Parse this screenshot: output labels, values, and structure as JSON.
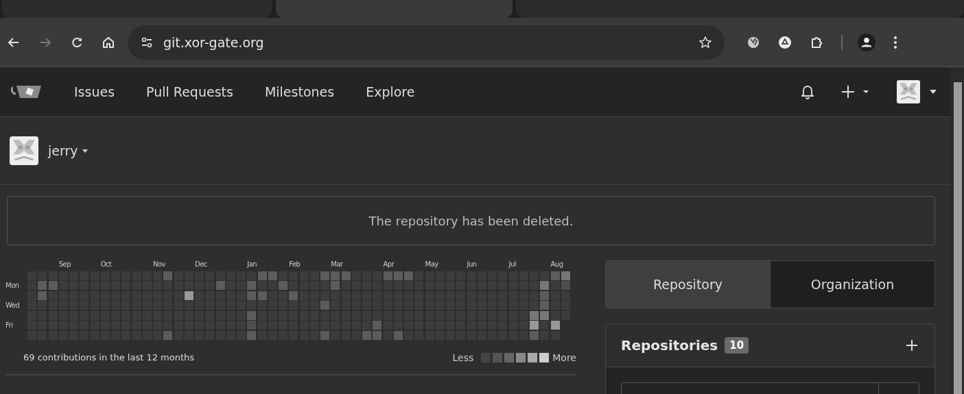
{
  "browser_tabs": [
    {
      "selected": false
    },
    {
      "selected": true
    },
    {
      "selected": false
    }
  ],
  "browser": {
    "url": "git.xor-gate.org",
    "forward_disabled": true
  },
  "nav": {
    "items": [
      "Issues",
      "Pull Requests",
      "Milestones",
      "Explore"
    ]
  },
  "user": {
    "name": "jerry"
  },
  "alert": "The repository has been deleted.",
  "heatmap": {
    "days": [
      "Mon",
      "Wed",
      "Fri"
    ],
    "weeks": [
      {
        "days": [
          {
            "color": "#3c3c3c"
          },
          {
            "color": "#3c3c3c"
          },
          {
            "color": "#3c3c3c"
          },
          {
            "color": "#3c3c3c"
          },
          {
            "color": "#3c3c3c"
          },
          {
            "color": "#3c3c3c"
          },
          {
            "color": "#3c3c3c"
          }
        ]
      },
      {
        "days": [
          {
            "color": "#3c3c3c"
          },
          {
            "color": "#5c5c5c"
          },
          {
            "color": "#5c5c5c"
          },
          {
            "color": "#3c3c3c"
          },
          {
            "color": "#3c3c3c"
          },
          {
            "color": "#3c3c3c"
          },
          {
            "color": "#3c3c3c"
          }
        ]
      },
      {
        "days": [
          {
            "color": "#3c3c3c"
          },
          {
            "color": "#5c5c5c"
          },
          {
            "color": "#3c3c3c"
          },
          {
            "color": "#3c3c3c"
          },
          {
            "color": "#3c3c3c"
          },
          {
            "color": "#3c3c3c"
          },
          {
            "color": "#3c3c3c"
          }
        ]
      },
      {
        "month": "Sep",
        "days": [
          {
            "color": "#3c3c3c"
          },
          {
            "color": "#3c3c3c"
          },
          {
            "color": "#3c3c3c"
          },
          {
            "color": "#3c3c3c"
          },
          {
            "color": "#3c3c3c"
          },
          {
            "color": "#3c3c3c"
          },
          {
            "color": "#3c3c3c"
          }
        ]
      },
      {
        "days": [
          {
            "color": "#3c3c3c"
          },
          {
            "color": "#3c3c3c"
          },
          {
            "color": "#3c3c3c"
          },
          {
            "color": "#3c3c3c"
          },
          {
            "color": "#3c3c3c"
          },
          {
            "color": "#3c3c3c"
          },
          {
            "color": "#3c3c3c"
          }
        ]
      },
      {
        "days": [
          {
            "color": "#3c3c3c"
          },
          {
            "color": "#3c3c3c"
          },
          {
            "color": "#3c3c3c"
          },
          {
            "color": "#3c3c3c"
          },
          {
            "color": "#3c3c3c"
          },
          {
            "color": "#3c3c3c"
          },
          {
            "color": "#3c3c3c"
          }
        ]
      },
      {
        "days": [
          {
            "color": "#3c3c3c"
          },
          {
            "color": "#3c3c3c"
          },
          {
            "color": "#3c3c3c"
          },
          {
            "color": "#3c3c3c"
          },
          {
            "color": "#3c3c3c"
          },
          {
            "color": "#3c3c3c"
          },
          {
            "color": "#3c3c3c"
          }
        ]
      },
      {
        "month": "Oct",
        "days": [
          {
            "color": "#3c3c3c"
          },
          {
            "color": "#3c3c3c"
          },
          {
            "color": "#3c3c3c"
          },
          {
            "color": "#3c3c3c"
          },
          {
            "color": "#3c3c3c"
          },
          {
            "color": "#3c3c3c"
          },
          {
            "color": "#3c3c3c"
          }
        ]
      },
      {
        "days": [
          {
            "color": "#3c3c3c"
          },
          {
            "color": "#3c3c3c"
          },
          {
            "color": "#3c3c3c"
          },
          {
            "color": "#3c3c3c"
          },
          {
            "color": "#3c3c3c"
          },
          {
            "color": "#3c3c3c"
          },
          {
            "color": "#3c3c3c"
          }
        ]
      },
      {
        "days": [
          {
            "color": "#3c3c3c"
          },
          {
            "color": "#3c3c3c"
          },
          {
            "color": "#3c3c3c"
          },
          {
            "color": "#3c3c3c"
          },
          {
            "color": "#3c3c3c"
          },
          {
            "color": "#3c3c3c"
          },
          {
            "color": "#3c3c3c"
          }
        ]
      },
      {
        "days": [
          {
            "color": "#3c3c3c"
          },
          {
            "color": "#3c3c3c"
          },
          {
            "color": "#3c3c3c"
          },
          {
            "color": "#3c3c3c"
          },
          {
            "color": "#3c3c3c"
          },
          {
            "color": "#3c3c3c"
          },
          {
            "color": "#3c3c3c"
          }
        ]
      },
      {
        "days": [
          {
            "color": "#3c3c3c"
          },
          {
            "color": "#3c3c3c"
          },
          {
            "color": "#3c3c3c"
          },
          {
            "color": "#3c3c3c"
          },
          {
            "color": "#3c3c3c"
          },
          {
            "color": "#3c3c3c"
          },
          {
            "color": "#3c3c3c"
          }
        ]
      },
      {
        "month": "Nov",
        "days": [
          {
            "color": "#3c3c3c"
          },
          {
            "color": "#3c3c3c"
          },
          {
            "color": "#3c3c3c"
          },
          {
            "color": "#3c3c3c"
          },
          {
            "color": "#3c3c3c"
          },
          {
            "color": "#3c3c3c"
          },
          {
            "color": "#3c3c3c"
          }
        ]
      },
      {
        "days": [
          {
            "color": "#5c5c5c"
          },
          {
            "color": "#3c3c3c"
          },
          {
            "color": "#3c3c3c"
          },
          {
            "color": "#3c3c3c"
          },
          {
            "color": "#3c3c3c"
          },
          {
            "color": "#3c3c3c"
          },
          {
            "color": "#5c5c5c"
          }
        ]
      },
      {
        "days": [
          {
            "color": "#3c3c3c"
          },
          {
            "color": "#3c3c3c"
          },
          {
            "color": "#3c3c3c"
          },
          {
            "color": "#3c3c3c"
          },
          {
            "color": "#3c3c3c"
          },
          {
            "color": "#3c3c3c"
          },
          {
            "color": "#3c3c3c"
          }
        ]
      },
      {
        "days": [
          {
            "color": "#3c3c3c"
          },
          {
            "color": "#3c3c3c"
          },
          {
            "color": "#999999"
          },
          {
            "color": "#3c3c3c"
          },
          {
            "color": "#3c3c3c"
          },
          {
            "color": "#3c3c3c"
          },
          {
            "color": "#3c3c3c"
          }
        ]
      },
      {
        "month": "Dec",
        "days": [
          {
            "color": "#3c3c3c"
          },
          {
            "color": "#3c3c3c"
          },
          {
            "color": "#3c3c3c"
          },
          {
            "color": "#3c3c3c"
          },
          {
            "color": "#3c3c3c"
          },
          {
            "color": "#3c3c3c"
          },
          {
            "color": "#3c3c3c"
          }
        ]
      },
      {
        "days": [
          {
            "color": "#3c3c3c"
          },
          {
            "color": "#3c3c3c"
          },
          {
            "color": "#3c3c3c"
          },
          {
            "color": "#3c3c3c"
          },
          {
            "color": "#3c3c3c"
          },
          {
            "color": "#3c3c3c"
          },
          {
            "color": "#3c3c3c"
          }
        ]
      },
      {
        "days": [
          {
            "color": "#3c3c3c"
          },
          {
            "color": "#5c5c5c"
          },
          {
            "color": "#3c3c3c"
          },
          {
            "color": "#3c3c3c"
          },
          {
            "color": "#3c3c3c"
          },
          {
            "color": "#3c3c3c"
          },
          {
            "color": "#3c3c3c"
          }
        ]
      },
      {
        "days": [
          {
            "color": "#3c3c3c"
          },
          {
            "color": "#3c3c3c"
          },
          {
            "color": "#3c3c3c"
          },
          {
            "color": "#3c3c3c"
          },
          {
            "color": "#3c3c3c"
          },
          {
            "color": "#3c3c3c"
          },
          {
            "color": "#3c3c3c"
          }
        ]
      },
      {
        "days": [
          {
            "color": "#3c3c3c"
          },
          {
            "color": "#3c3c3c"
          },
          {
            "color": "#3c3c3c"
          },
          {
            "color": "#3c3c3c"
          },
          {
            "color": "#3c3c3c"
          },
          {
            "color": "#3c3c3c"
          },
          {
            "color": "#3c3c3c"
          }
        ]
      },
      {
        "month": "Jan",
        "days": [
          {
            "color": "#3c3c3c"
          },
          {
            "color": "#5c5c5c"
          },
          {
            "color": "#5c5c5c"
          },
          {
            "color": "#3c3c3c"
          },
          {
            "color": "#5c5c5c"
          },
          {
            "color": "#4e4e4e"
          },
          {
            "color": "#5c5c5c"
          }
        ]
      },
      {
        "days": [
          {
            "color": "#5c5c5c"
          },
          {
            "color": "#3c3c3c"
          },
          {
            "color": "#5c5c5c"
          },
          {
            "color": "#3c3c3c"
          },
          {
            "color": "#3c3c3c"
          },
          {
            "color": "#3c3c3c"
          },
          {
            "color": "#3c3c3c"
          }
        ]
      },
      {
        "days": [
          {
            "color": "#5c5c5c"
          },
          {
            "color": "#3c3c3c"
          },
          {
            "color": "#3c3c3c"
          },
          {
            "color": "#3c3c3c"
          },
          {
            "color": "#3c3c3c"
          },
          {
            "color": "#3c3c3c"
          },
          {
            "color": "#3c3c3c"
          }
        ]
      },
      {
        "days": [
          {
            "color": "#3c3c3c"
          },
          {
            "color": "#5c5c5c"
          },
          {
            "color": "#3c3c3c"
          },
          {
            "color": "#3c3c3c"
          },
          {
            "color": "#3c3c3c"
          },
          {
            "color": "#3c3c3c"
          },
          {
            "color": "#3c3c3c"
          }
        ]
      },
      {
        "month": "Feb",
        "days": [
          {
            "color": "#3c3c3c"
          },
          {
            "color": "#3c3c3c"
          },
          {
            "color": "#5c5c5c"
          },
          {
            "color": "#3c3c3c"
          },
          {
            "color": "#3c3c3c"
          },
          {
            "color": "#3c3c3c"
          },
          {
            "color": "#3c3c3c"
          }
        ]
      },
      {
        "days": [
          {
            "color": "#3c3c3c"
          },
          {
            "color": "#3c3c3c"
          },
          {
            "color": "#3c3c3c"
          },
          {
            "color": "#3c3c3c"
          },
          {
            "color": "#3c3c3c"
          },
          {
            "color": "#3c3c3c"
          },
          {
            "color": "#3c3c3c"
          }
        ]
      },
      {
        "days": [
          {
            "color": "#3c3c3c"
          },
          {
            "color": "#3c3c3c"
          },
          {
            "color": "#3c3c3c"
          },
          {
            "color": "#3c3c3c"
          },
          {
            "color": "#3c3c3c"
          },
          {
            "color": "#3c3c3c"
          },
          {
            "color": "#3c3c3c"
          }
        ]
      },
      {
        "days": [
          {
            "color": "#5c5c5c"
          },
          {
            "color": "#3c3c3c"
          },
          {
            "color": "#3c3c3c"
          },
          {
            "color": "#5c5c5c"
          },
          {
            "color": "#3c3c3c"
          },
          {
            "color": "#3c3c3c"
          },
          {
            "color": "#5c5c5c"
          }
        ]
      },
      {
        "month": "Mar",
        "days": [
          {
            "color": "#5c5c5c"
          },
          {
            "color": "#5c5c5c"
          },
          {
            "color": "#3c3c3c"
          },
          {
            "color": "#3c3c3c"
          },
          {
            "color": "#3c3c3c"
          },
          {
            "color": "#3c3c3c"
          },
          {
            "color": "#3c3c3c"
          }
        ]
      },
      {
        "days": [
          {
            "color": "#5c5c5c"
          },
          {
            "color": "#3c3c3c"
          },
          {
            "color": "#3c3c3c"
          },
          {
            "color": "#3c3c3c"
          },
          {
            "color": "#3c3c3c"
          },
          {
            "color": "#3c3c3c"
          },
          {
            "color": "#3c3c3c"
          }
        ]
      },
      {
        "days": [
          {
            "color": "#3c3c3c"
          },
          {
            "color": "#3c3c3c"
          },
          {
            "color": "#3c3c3c"
          },
          {
            "color": "#3c3c3c"
          },
          {
            "color": "#3c3c3c"
          },
          {
            "color": "#3c3c3c"
          },
          {
            "color": "#3c3c3c"
          }
        ]
      },
      {
        "days": [
          {
            "color": "#3c3c3c"
          },
          {
            "color": "#3c3c3c"
          },
          {
            "color": "#3c3c3c"
          },
          {
            "color": "#3c3c3c"
          },
          {
            "color": "#3c3c3c"
          },
          {
            "color": "#3c3c3c"
          },
          {
            "color": "#5c5c5c"
          }
        ]
      },
      {
        "days": [
          {
            "color": "#3c3c3c"
          },
          {
            "color": "#3c3c3c"
          },
          {
            "color": "#3c3c3c"
          },
          {
            "color": "#3c3c3c"
          },
          {
            "color": "#3c3c3c"
          },
          {
            "color": "#5c5c5c"
          },
          {
            "color": "#5c5c5c"
          }
        ]
      },
      {
        "month": "Apr",
        "days": [
          {
            "color": "#5c5c5c"
          },
          {
            "color": "#3c3c3c"
          },
          {
            "color": "#3c3c3c"
          },
          {
            "color": "#3c3c3c"
          },
          {
            "color": "#3c3c3c"
          },
          {
            "color": "#3c3c3c"
          },
          {
            "color": "#3c3c3c"
          }
        ]
      },
      {
        "days": [
          {
            "color": "#5c5c5c"
          },
          {
            "color": "#3c3c3c"
          },
          {
            "color": "#3c3c3c"
          },
          {
            "color": "#3c3c3c"
          },
          {
            "color": "#3c3c3c"
          },
          {
            "color": "#3c3c3c"
          },
          {
            "color": "#5c5c5c"
          }
        ]
      },
      {
        "days": [
          {
            "color": "#5c5c5c"
          },
          {
            "color": "#3c3c3c"
          },
          {
            "color": "#3c3c3c"
          },
          {
            "color": "#3c3c3c"
          },
          {
            "color": "#3c3c3c"
          },
          {
            "color": "#3c3c3c"
          },
          {
            "color": "#3c3c3c"
          }
        ]
      },
      {
        "days": [
          {
            "color": "#3c3c3c"
          },
          {
            "color": "#3c3c3c"
          },
          {
            "color": "#3c3c3c"
          },
          {
            "color": "#3c3c3c"
          },
          {
            "color": "#3c3c3c"
          },
          {
            "color": "#3c3c3c"
          },
          {
            "color": "#3c3c3c"
          }
        ]
      },
      {
        "month": "May",
        "days": [
          {
            "color": "#3c3c3c"
          },
          {
            "color": "#3c3c3c"
          },
          {
            "color": "#3c3c3c"
          },
          {
            "color": "#3c3c3c"
          },
          {
            "color": "#3c3c3c"
          },
          {
            "color": "#3c3c3c"
          },
          {
            "color": "#3c3c3c"
          }
        ]
      },
      {
        "days": [
          {
            "color": "#3c3c3c"
          },
          {
            "color": "#3c3c3c"
          },
          {
            "color": "#3c3c3c"
          },
          {
            "color": "#3c3c3c"
          },
          {
            "color": "#3c3c3c"
          },
          {
            "color": "#3c3c3c"
          },
          {
            "color": "#3c3c3c"
          }
        ]
      },
      {
        "days": [
          {
            "color": "#3c3c3c"
          },
          {
            "color": "#3c3c3c"
          },
          {
            "color": "#3c3c3c"
          },
          {
            "color": "#3c3c3c"
          },
          {
            "color": "#3c3c3c"
          },
          {
            "color": "#3c3c3c"
          },
          {
            "color": "#3c3c3c"
          }
        ]
      },
      {
        "days": [
          {
            "color": "#3c3c3c"
          },
          {
            "color": "#3c3c3c"
          },
          {
            "color": "#3c3c3c"
          },
          {
            "color": "#3c3c3c"
          },
          {
            "color": "#3c3c3c"
          },
          {
            "color": "#3c3c3c"
          },
          {
            "color": "#3c3c3c"
          }
        ]
      },
      {
        "month": "Jun",
        "days": [
          {
            "color": "#3c3c3c"
          },
          {
            "color": "#3c3c3c"
          },
          {
            "color": "#3c3c3c"
          },
          {
            "color": "#3c3c3c"
          },
          {
            "color": "#3c3c3c"
          },
          {
            "color": "#3c3c3c"
          },
          {
            "color": "#3c3c3c"
          }
        ]
      },
      {
        "days": [
          {
            "color": "#3c3c3c"
          },
          {
            "color": "#3c3c3c"
          },
          {
            "color": "#3c3c3c"
          },
          {
            "color": "#3c3c3c"
          },
          {
            "color": "#3c3c3c"
          },
          {
            "color": "#3c3c3c"
          },
          {
            "color": "#3c3c3c"
          }
        ]
      },
      {
        "days": [
          {
            "color": "#3c3c3c"
          },
          {
            "color": "#3c3c3c"
          },
          {
            "color": "#3c3c3c"
          },
          {
            "color": "#3c3c3c"
          },
          {
            "color": "#3c3c3c"
          },
          {
            "color": "#3c3c3c"
          },
          {
            "color": "#3c3c3c"
          }
        ]
      },
      {
        "days": [
          {
            "color": "#3c3c3c"
          },
          {
            "color": "#3c3c3c"
          },
          {
            "color": "#3c3c3c"
          },
          {
            "color": "#3c3c3c"
          },
          {
            "color": "#3c3c3c"
          },
          {
            "color": "#3c3c3c"
          },
          {
            "color": "#3c3c3c"
          }
        ]
      },
      {
        "month": "Jul",
        "days": [
          {
            "color": "#3c3c3c"
          },
          {
            "color": "#3c3c3c"
          },
          {
            "color": "#3c3c3c"
          },
          {
            "color": "#3c3c3c"
          },
          {
            "color": "#3c3c3c"
          },
          {
            "color": "#3c3c3c"
          },
          {
            "color": "#3c3c3c"
          }
        ]
      },
      {
        "days": [
          {
            "color": "#3c3c3c"
          },
          {
            "color": "#3c3c3c"
          },
          {
            "color": "#3c3c3c"
          },
          {
            "color": "#3c3c3c"
          },
          {
            "color": "#3c3c3c"
          },
          {
            "color": "#3c3c3c"
          },
          {
            "color": "#3c3c3c"
          }
        ]
      },
      {
        "days": [
          {
            "color": "#3c3c3c"
          },
          {
            "color": "#3c3c3c"
          },
          {
            "color": "#3c3c3c"
          },
          {
            "color": "#3c3c3c"
          },
          {
            "color": "#777777"
          },
          {
            "color": "#999999"
          },
          {
            "color": "#5c5c5c"
          }
        ]
      },
      {
        "days": [
          {
            "color": "#3c3c3c"
          },
          {
            "color": "#777777"
          },
          {
            "color": "#5c5c5c"
          },
          {
            "color": "#5c5c5c"
          },
          {
            "color": "#777777"
          },
          {
            "color": "#3c3c3c"
          },
          {
            "color": "#3c3c3c"
          }
        ]
      },
      {
        "month": "Aug",
        "days": [
          {
            "color": "#5c5c5c"
          },
          {
            "color": "#3c3c3c"
          },
          {
            "color": "#3c3c3c"
          },
          {
            "color": "#3c3c3c"
          },
          {
            "color": "#3c3c3c"
          },
          {
            "color": "#999999"
          },
          {
            "color": "#3c3c3c"
          }
        ]
      },
      {
        "days": [
          {
            "color": "#777777"
          },
          {
            "color": "#4e4e4e"
          },
          {
            "color": "#3c3c3c"
          },
          {
            "color": "#3c3c3c"
          },
          {
            "color": "#3c3c3c"
          }
        ]
      }
    ],
    "summary": "69 contributions in the last 12 months",
    "less": "Less",
    "more": "More"
  },
  "tabs": [
    {
      "label": "Repository",
      "selected": true
    },
    {
      "label": "Organization",
      "selected": false
    }
  ],
  "repositories": {
    "title": "Repositories",
    "count": "10"
  }
}
